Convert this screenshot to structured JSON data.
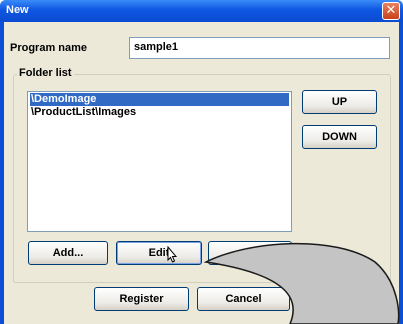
{
  "window": {
    "title": "New",
    "close_glyph": "✕"
  },
  "program": {
    "label": "Program name",
    "value": "sample1"
  },
  "folder_list": {
    "label": "Folder list",
    "items": [
      "\\DemoImage",
      "\\ProductList\\Images"
    ],
    "selected_index": 0
  },
  "buttons": {
    "up": "UP",
    "down": "DOWN",
    "add": "Add...",
    "edit": "Edit",
    "register": "Register",
    "cancel": "Cancel"
  },
  "colors": {
    "title_bar": "#0a4fd6",
    "selection": "#316ac5",
    "dialog_bg": "#ece9d8",
    "overlay_shape": "#c4c4c4"
  },
  "icons": {
    "close": "close-icon",
    "cursor": "mouse-pointer-icon"
  }
}
